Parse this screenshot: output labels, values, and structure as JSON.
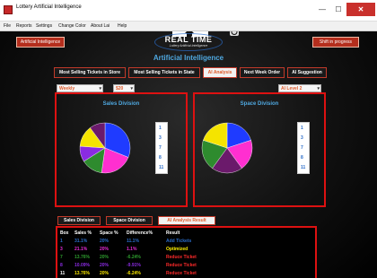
{
  "window": {
    "title": "Lottery Artificial Intelligence",
    "min": "—",
    "max": "☐",
    "close": "✕"
  },
  "menu": [
    "File",
    "Reports",
    "Settings",
    "Change Color",
    "About Lai",
    "Help"
  ],
  "top": {
    "left_button": "Artificial Intelligence",
    "right_button": "Shift in progress",
    "home_icon": "home-icon",
    "power_icon": "power-icon"
  },
  "logo": {
    "title": "REAL TIME",
    "subtitle": "Lottery Artificial Intelligence"
  },
  "headline": "Artificial Intelligence",
  "tabs": [
    "Most Selling Tickets in Store",
    "Most Selling Tickets in State",
    "AI Analysis",
    "Next Week Order",
    "AI Suggestion"
  ],
  "active_tab": "AI Analysis",
  "selects": {
    "period": "Weekly",
    "amount": "$20",
    "level": "AI Level 2"
  },
  "panels": [
    {
      "title": "Sales Division",
      "legend": [
        "1",
        "3",
        "7",
        "8",
        "11"
      ],
      "slices": [
        {
          "label": "1",
          "percent": 31.1,
          "color": "#1f3bff"
        },
        {
          "label": "3",
          "percent": 21.1,
          "color": "#ff2fd0"
        },
        {
          "label": "7",
          "percent": 13.8,
          "color": "#2e8b2e"
        },
        {
          "label": "8",
          "percent": 10.1,
          "color": "#8a2be2"
        },
        {
          "label": "11",
          "percent": 13.8,
          "color": "#f5e400"
        },
        {
          "label": "",
          "percent": 10.1,
          "color": "#6b1a6b"
        }
      ]
    },
    {
      "title": "Space Division",
      "legend": [
        "1",
        "3",
        "7",
        "8",
        "11"
      ],
      "slices": [
        {
          "label": "1",
          "percent": 20,
          "color": "#1f3bff"
        },
        {
          "label": "3",
          "percent": 20,
          "color": "#ff2fd0"
        },
        {
          "label": "7",
          "percent": 20,
          "color": "#6b1a6b"
        },
        {
          "label": "8",
          "percent": 20,
          "color": "#2e8b2e"
        },
        {
          "label": "11",
          "percent": 20,
          "color": "#f5e400"
        }
      ]
    }
  ],
  "bottom_tabs": [
    "Sales Division",
    "Space Division",
    "AI Analysis Result"
  ],
  "active_bottom_tab": "AI Analysis Result",
  "table": {
    "headers": [
      "Box",
      "Sales %",
      "Space %",
      "Difference%",
      "Result"
    ],
    "rows": [
      {
        "box": "1",
        "sales": "31.1%",
        "space": "20%",
        "diff": "11.1%",
        "result": "Add Tickets",
        "color": "#2a6cc9"
      },
      {
        "box": "3",
        "sales": "21.1%",
        "space": "20%",
        "diff": "1.1%",
        "result": "Optimized",
        "color": "#e82ad8"
      },
      {
        "box": "7",
        "sales": "13.76%",
        "space": "20%",
        "diff": "-6.24%",
        "result": "Reduce Ticket",
        "color": "#2e9b2e"
      },
      {
        "box": "8",
        "sales": "10.09%",
        "space": "20%",
        "diff": "-9.91%",
        "result": "Reduce Ticket",
        "color": "#8a2be2"
      },
      {
        "box": "11",
        "sales": "13.76%",
        "space": "20%",
        "diff": "-6.24%",
        "result": "Reduce Ticket",
        "color": "#f5e400"
      }
    ]
  }
}
